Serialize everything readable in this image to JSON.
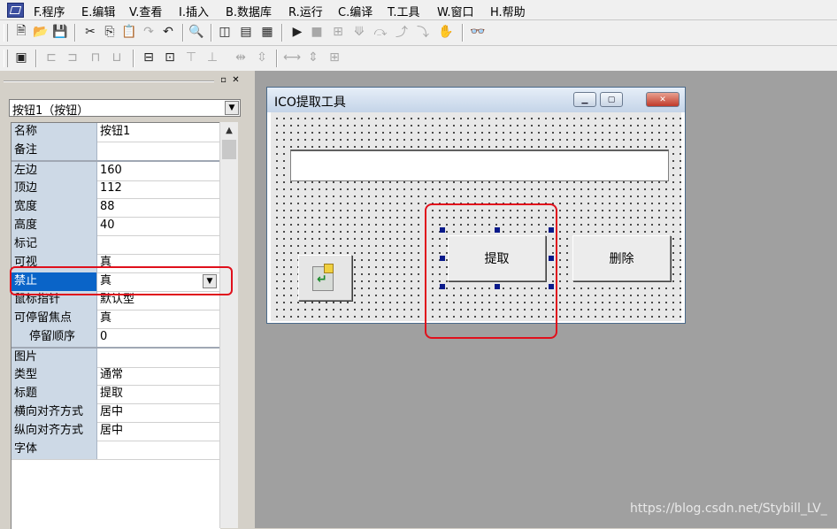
{
  "menu": [
    "F.程序",
    "E.编辑",
    "V.查看",
    "I.插入",
    "B.数据库",
    "R.运行",
    "C.编译",
    "T.工具",
    "W.窗口",
    "H.帮助"
  ],
  "toolbar1_icons": [
    "new-icon",
    "open-icon",
    "save-icon",
    "cut-icon",
    "copy-icon",
    "paste-icon",
    "redo-icon",
    "undo-icon",
    "find-icon",
    "window-layout-1-icon",
    "window-layout-2-icon",
    "window-layout-3-icon",
    "run-icon",
    "stop-icon",
    "step-icon",
    "step-into-icon",
    "step-over-icon",
    "step-out-icon",
    "run-to-cursor-icon",
    "breakpoint-icon",
    "find-binoculars-icon"
  ],
  "toolbar2_icons": [
    "form-icon",
    "align-left-icon",
    "align-right-icon",
    "align-top-icon",
    "align-bottom-icon",
    "center-h-icon",
    "center-v-icon",
    "same-width-icon",
    "same-height-icon",
    "space-h-icon",
    "space-v-icon",
    "size-icon",
    "order-icon",
    "grid-icon"
  ],
  "property_panel": {
    "object_selector": "按钮1（按钮）",
    "rows": [
      {
        "key": "名称",
        "value": "按钮1"
      },
      {
        "key": "备注",
        "value": ""
      },
      {
        "key": "左边",
        "value": "160"
      },
      {
        "key": "顶边",
        "value": "112"
      },
      {
        "key": "宽度",
        "value": "88"
      },
      {
        "key": "高度",
        "value": "40"
      },
      {
        "key": "标记",
        "value": ""
      },
      {
        "key": "可视",
        "value": "真"
      },
      {
        "key": "禁止",
        "value": "真"
      },
      {
        "key": "鼠标指针",
        "value": "默认型"
      },
      {
        "key": "可停留焦点",
        "value": "真"
      },
      {
        "key": "停留顺序",
        "value": "0"
      },
      {
        "key": "图片",
        "value": ""
      },
      {
        "key": "类型",
        "value": "通常"
      },
      {
        "key": "标题",
        "value": "提取"
      },
      {
        "key": "横向对齐方式",
        "value": "居中"
      },
      {
        "key": "纵向对齐方式",
        "value": "居中"
      },
      {
        "key": "字体",
        "value": ""
      }
    ]
  },
  "form_window": {
    "title": "ICO提取工具",
    "extract_button": "提取",
    "delete_button": "删除",
    "text_field_value": ""
  },
  "watermark": "https://blog.csdn.net/Stybill_LV_"
}
